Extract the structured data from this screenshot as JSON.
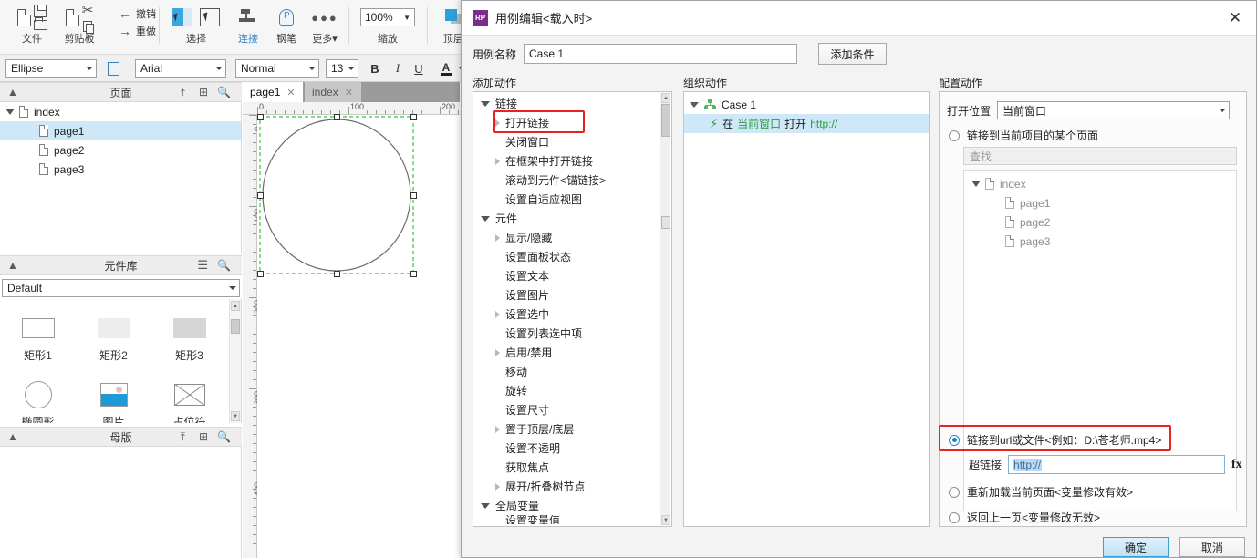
{
  "app": {
    "ribbon": {
      "groups": [
        {
          "label": "文件",
          "icons": [
            "new-file-icon",
            "save-icon",
            "open-folder-icon"
          ]
        },
        {
          "label": "剪贴板",
          "icons": [
            "paste-icon",
            "cut-icon",
            "copy-icon"
          ]
        },
        {
          "label": "",
          "icons": [
            "undo-icon",
            "redo-icon"
          ],
          "items": [
            "撤销",
            "重做"
          ]
        },
        {
          "label": "选择",
          "icons": [
            "select-mode-icon",
            "select-marquee-icon"
          ]
        },
        {
          "label": "连接",
          "icons": [
            "connector-icon"
          ]
        },
        {
          "label": "钢笔",
          "icons": [
            "pen-icon"
          ]
        },
        {
          "label": "更多",
          "icons": [
            "more-dots-icon"
          ]
        },
        {
          "label": "缩放",
          "icons": [
            "zoom-combo"
          ]
        },
        {
          "label": "顶层",
          "icons": [
            "bring-front-icon"
          ]
        }
      ],
      "undo_label": "撤销",
      "redo_label": "重做",
      "zoom_value": "100%"
    },
    "formatbar": {
      "shape": "Ellipse",
      "font_family": "Arial",
      "font_style": "Normal",
      "font_size": "13",
      "bold": "B",
      "italic": "I",
      "underline": "U",
      "text_color": "A"
    },
    "pages_panel": {
      "title": "页面",
      "tree": [
        {
          "label": "index",
          "level": 0,
          "expanded": true,
          "selected": false
        },
        {
          "label": "page1",
          "level": 1,
          "expanded": false,
          "selected": true
        },
        {
          "label": "page2",
          "level": 1,
          "expanded": false,
          "selected": false
        },
        {
          "label": "page3",
          "level": 1,
          "expanded": false,
          "selected": false
        }
      ]
    },
    "widgets_panel": {
      "title": "元件库",
      "library": "Default",
      "items": [
        {
          "label": "矩形1",
          "icon": "rectangle-outline-icon"
        },
        {
          "label": "矩形2",
          "icon": "rectangle-light-icon"
        },
        {
          "label": "矩形3",
          "icon": "rectangle-dark-icon"
        },
        {
          "label": "椭圆形",
          "icon": "ellipse-icon"
        },
        {
          "label": "图片",
          "icon": "image-icon"
        },
        {
          "label": "占位符",
          "icon": "placeholder-icon"
        }
      ]
    },
    "masters_panel": {
      "title": "母版"
    },
    "canvas": {
      "tabs": [
        {
          "label": "page1",
          "active": true
        },
        {
          "label": "index",
          "active": false
        }
      ],
      "ruler_h": [
        "0",
        "100",
        "200"
      ],
      "ruler_v": [
        "0",
        "100",
        "200",
        "300",
        "400"
      ],
      "shape": "ellipse-selected"
    }
  },
  "dialog": {
    "title": "用例编辑<载入时>",
    "logo": "RP",
    "close_icon": "close-icon",
    "case_name_label": "用例名称",
    "case_name_value": "Case 1",
    "add_condition_label": "添加条件",
    "columns": {
      "add_action": "添加动作",
      "organize_action": "组织动作",
      "configure_action": "配置动作"
    },
    "action_tree": [
      {
        "label": "链接",
        "level": 0,
        "arrow": "down",
        "group": true
      },
      {
        "label": "打开链接",
        "level": 1,
        "arrow": "right",
        "highlighted": true
      },
      {
        "label": "关闭窗口",
        "level": 1,
        "arrow": "none"
      },
      {
        "label": "在框架中打开链接",
        "level": 1,
        "arrow": "right"
      },
      {
        "label": "滚动到元件<锚链接>",
        "level": 1,
        "arrow": "none"
      },
      {
        "label": "设置自适应视图",
        "level": 1,
        "arrow": "none"
      },
      {
        "label": "元件",
        "level": 0,
        "arrow": "down",
        "group": true
      },
      {
        "label": "显示/隐藏",
        "level": 1,
        "arrow": "right"
      },
      {
        "label": "设置面板状态",
        "level": 1,
        "arrow": "none"
      },
      {
        "label": "设置文本",
        "level": 1,
        "arrow": "none"
      },
      {
        "label": "设置图片",
        "level": 1,
        "arrow": "none"
      },
      {
        "label": "设置选中",
        "level": 1,
        "arrow": "right"
      },
      {
        "label": "设置列表选中项",
        "level": 1,
        "arrow": "none"
      },
      {
        "label": "启用/禁用",
        "level": 1,
        "arrow": "right"
      },
      {
        "label": "移动",
        "level": 1,
        "arrow": "none"
      },
      {
        "label": "旋转",
        "level": 1,
        "arrow": "none"
      },
      {
        "label": "设置尺寸",
        "level": 1,
        "arrow": "none"
      },
      {
        "label": "置于顶层/底层",
        "level": 1,
        "arrow": "right"
      },
      {
        "label": "设置不透明",
        "level": 1,
        "arrow": "none"
      },
      {
        "label": "获取焦点",
        "level": 1,
        "arrow": "none"
      },
      {
        "label": "展开/折叠树节点",
        "level": 1,
        "arrow": "right"
      },
      {
        "label": "全局变量",
        "level": 0,
        "arrow": "down",
        "group": true
      },
      {
        "label": "设置变量值",
        "level": 1,
        "arrow": "none",
        "clipped": true
      }
    ],
    "organize": {
      "case_label": "Case 1",
      "action_prefix": "在",
      "action_target": "当前窗口",
      "action_verb": "打开",
      "action_url": "http://"
    },
    "configure": {
      "open_in_label": "打开位置",
      "open_in_value": "当前窗口",
      "option_page": "链接到当前项目的某个页面",
      "search_placeholder": "查找",
      "page_tree": [
        {
          "label": "index",
          "level": 0,
          "expanded": true
        },
        {
          "label": "page1",
          "level": 1
        },
        {
          "label": "page2",
          "level": 1
        },
        {
          "label": "page3",
          "level": 1
        }
      ],
      "option_url": "链接到url或文件<例如：D:\\苍老师.mp4>",
      "option_url_selected": true,
      "hyperlink_label": "超链接",
      "hyperlink_value": "http://",
      "fx_label": "fx",
      "option_reload": "重新加载当前页面<变量修改有效>",
      "option_back": "返回上一页<变量修改无效>"
    },
    "ok_label": "确定",
    "cancel_label": "取消"
  },
  "colors": {
    "highlight_red": "#e8221f",
    "selection_blue": "#cfe8f7",
    "accent_blue": "#1b7fc4",
    "green": "#2e9a3e",
    "purple": "#7b2d8e"
  }
}
